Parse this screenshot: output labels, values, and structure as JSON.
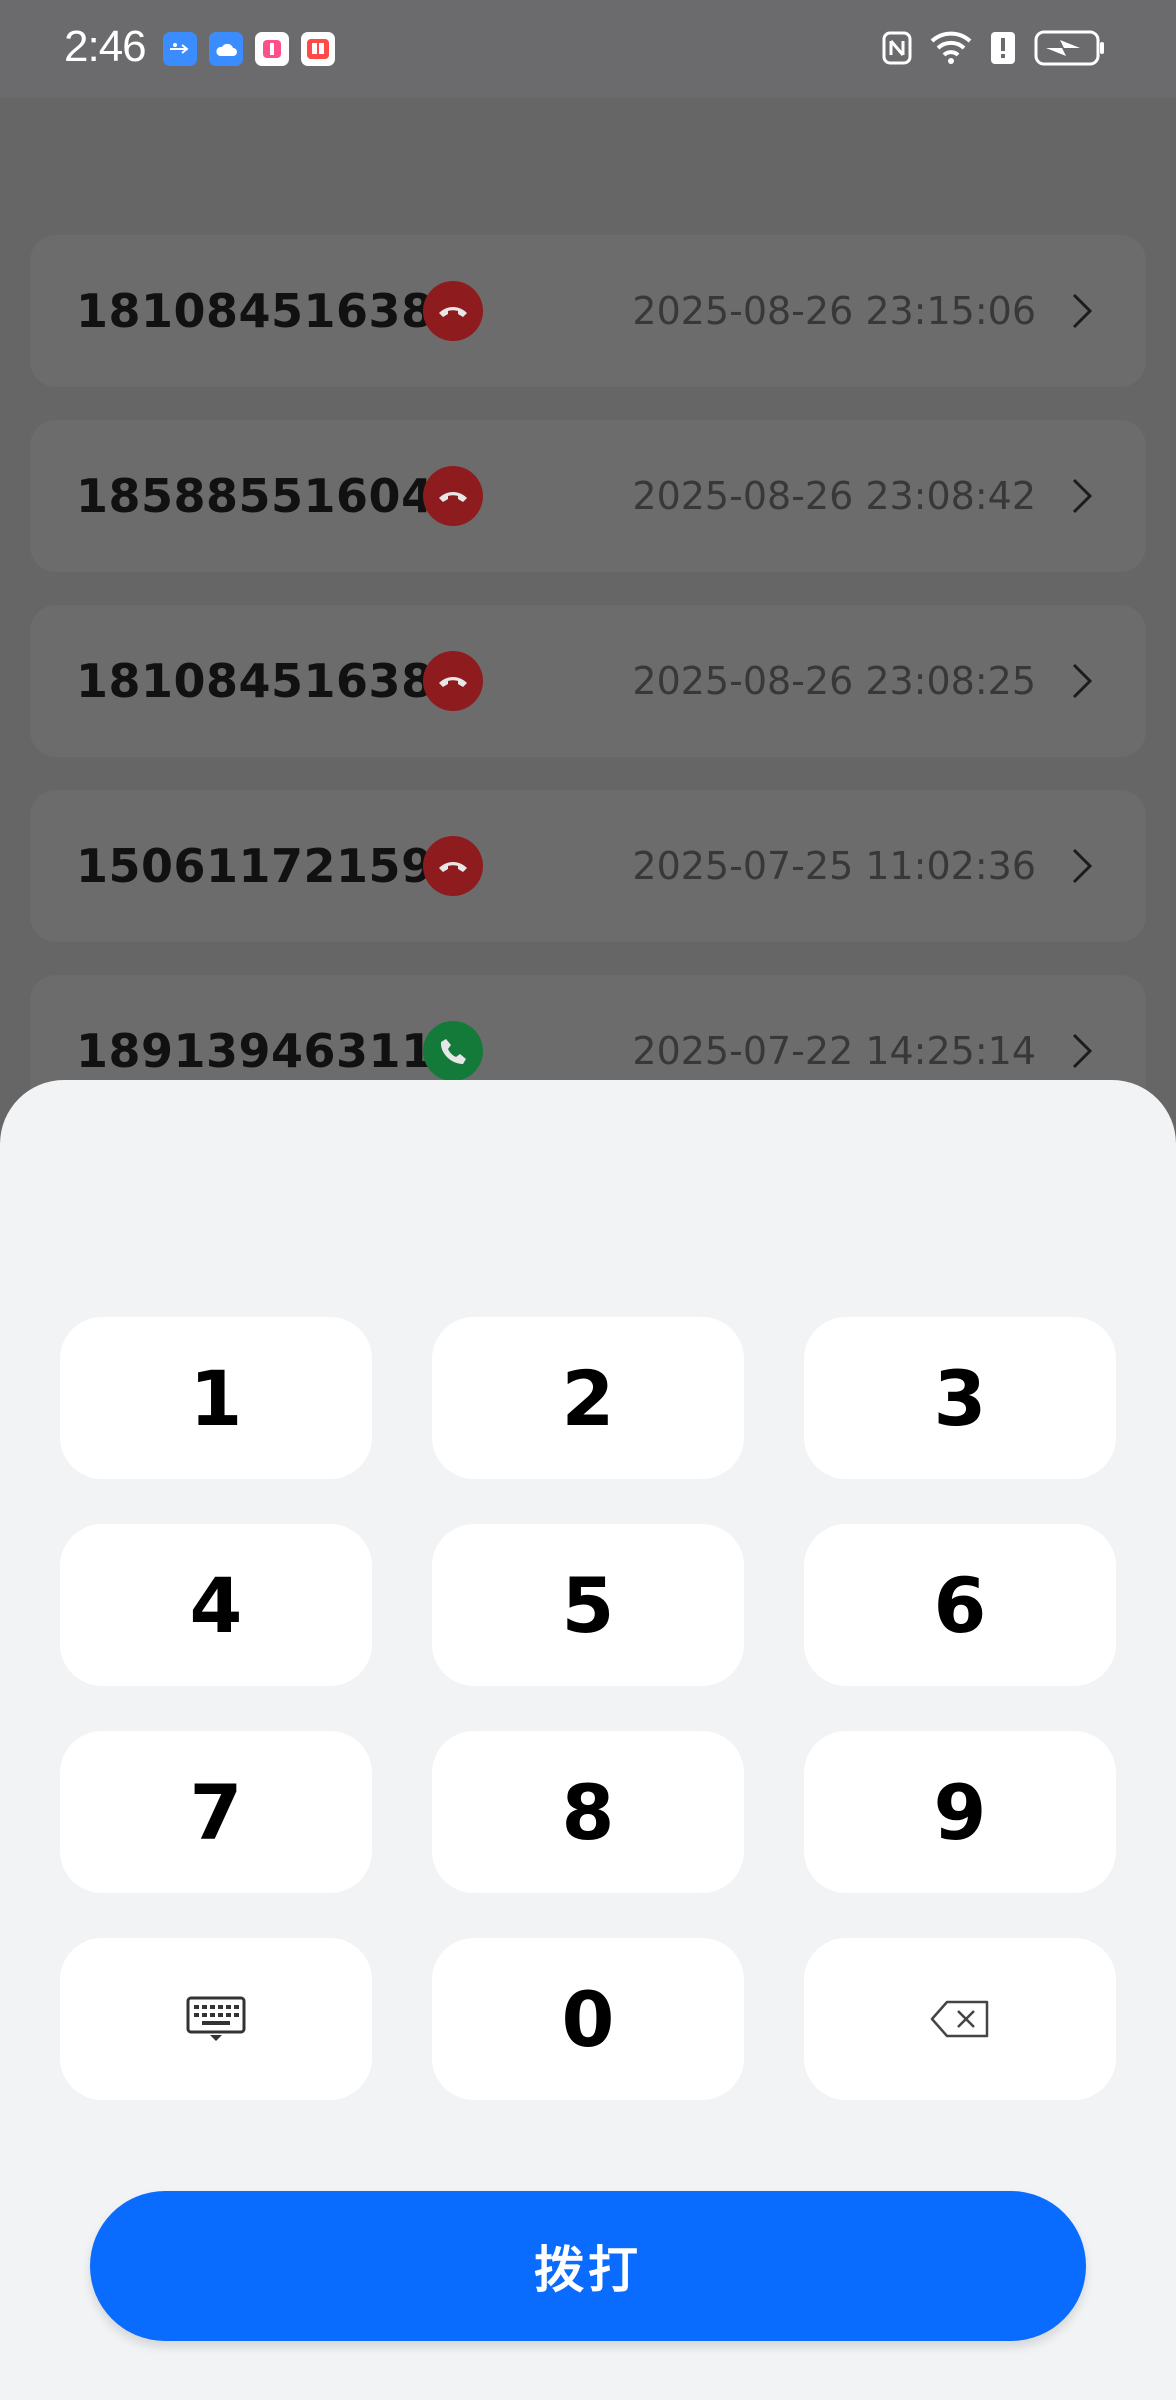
{
  "status_bar": {
    "time": "2:46",
    "notification_icons": [
      "usb-icon",
      "cloud-icon",
      "app-icon",
      "book-icon"
    ],
    "system_icons": [
      "nfc-icon",
      "wifi-icon",
      "alert-icon",
      "battery-charging-icon"
    ]
  },
  "call_log": [
    {
      "number": "18108451638",
      "type": "missed",
      "time": "2025-08-26 23:15:06"
    },
    {
      "number": "18588551604",
      "type": "missed",
      "time": "2025-08-26 23:08:42"
    },
    {
      "number": "18108451638",
      "type": "missed",
      "time": "2025-08-26 23:08:25"
    },
    {
      "number": "15061172159",
      "type": "missed",
      "time": "2025-07-25 11:02:36"
    },
    {
      "number": "18913946311",
      "type": "answered",
      "time": "2025-07-22 14:25:14"
    }
  ],
  "keypad": {
    "keys": [
      "1",
      "2",
      "3",
      "4",
      "5",
      "6",
      "7",
      "8",
      "9",
      "",
      "0",
      ""
    ],
    "keyboard_icon": "keyboard-icon",
    "backspace_icon": "backspace-icon"
  },
  "call_button_label": "拨打",
  "colors": {
    "missed": "#8e1c1f",
    "answered": "#137a3a",
    "accent": "#0a6cff",
    "sheet": "#f1f3f5"
  }
}
